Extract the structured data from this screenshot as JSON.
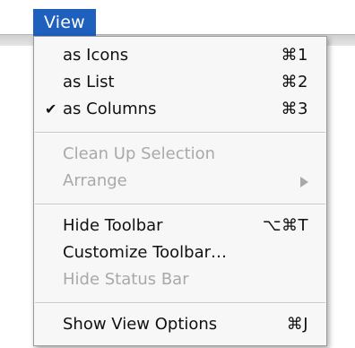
{
  "menubar": {
    "menu_title": "View"
  },
  "menu": {
    "items": [
      {
        "label": "as Icons",
        "shortcut": "⌘1",
        "checked": false,
        "enabled": true
      },
      {
        "label": "as List",
        "shortcut": "⌘2",
        "checked": false,
        "enabled": true
      },
      {
        "label": "as Columns",
        "shortcut": "⌘3",
        "checked": true,
        "check_glyph": "✔",
        "enabled": true
      },
      {
        "label": "Clean Up Selection",
        "shortcut": "",
        "checked": false,
        "enabled": false
      },
      {
        "label": "Arrange",
        "shortcut": "",
        "checked": false,
        "enabled": false,
        "submenu_icon": "chevron-right-icon"
      },
      {
        "label": "Hide Toolbar",
        "shortcut": "⌥⌘T",
        "checked": false,
        "enabled": true
      },
      {
        "label": "Customize Toolbar…",
        "shortcut": "",
        "checked": false,
        "enabled": true
      },
      {
        "label": "Hide Status Bar",
        "shortcut": "",
        "checked": false,
        "enabled": false
      },
      {
        "label": "Show View Options",
        "shortcut": "⌘J",
        "checked": false,
        "enabled": true
      }
    ]
  },
  "colors": {
    "menu_title_highlight": "#1f5fbd",
    "enabled_text": "#111111",
    "disabled_text": "#a9a9a9"
  }
}
